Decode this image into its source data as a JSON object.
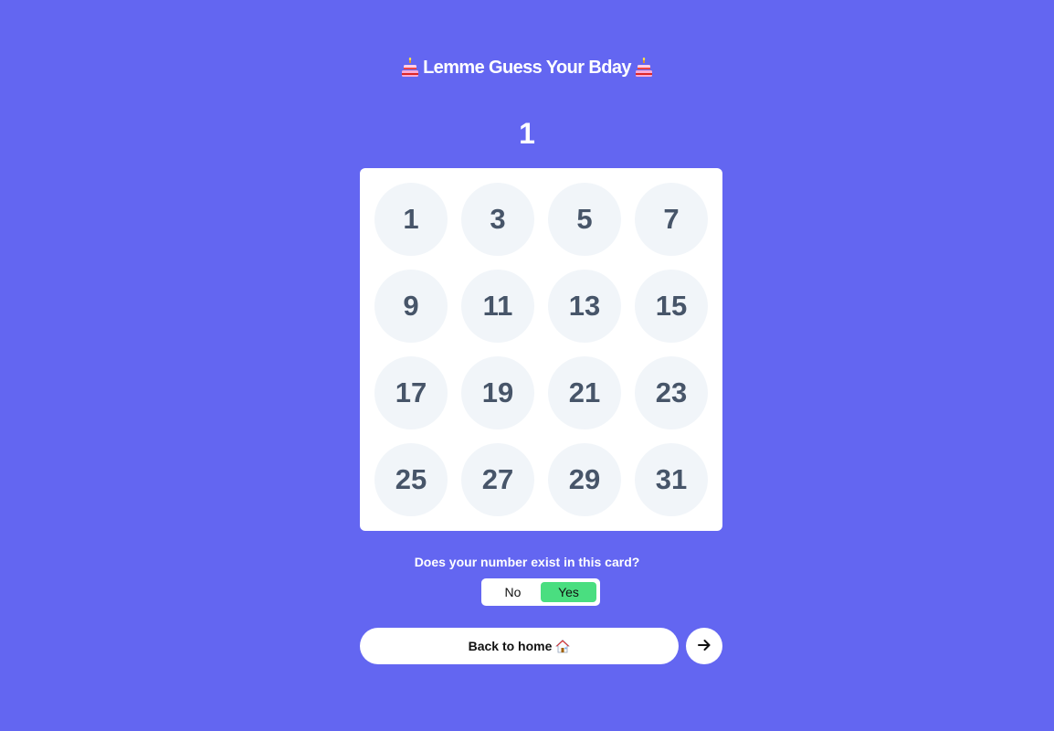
{
  "header": {
    "title": "Lemme Guess Your Bday",
    "left_icon": "birthday-cake-icon",
    "right_icon": "birthday-cake-icon"
  },
  "card": {
    "index_label": "1",
    "numbers": [
      "1",
      "3",
      "5",
      "7",
      "9",
      "11",
      "13",
      "15",
      "17",
      "19",
      "21",
      "23",
      "25",
      "27",
      "29",
      "31"
    ]
  },
  "question": {
    "text": "Does your number exist in this card?",
    "options": [
      {
        "label": "No",
        "selected": false
      },
      {
        "label": "Yes",
        "selected": true
      }
    ]
  },
  "actions": {
    "home_label": "Back to home",
    "home_icon": "house-icon",
    "next_icon": "arrow-right-icon"
  },
  "colors": {
    "background": "#6366f1",
    "card": "#ffffff",
    "number_bubble": "#f1f5f9",
    "number_text": "#475569",
    "selected_option": "#4ade80"
  }
}
